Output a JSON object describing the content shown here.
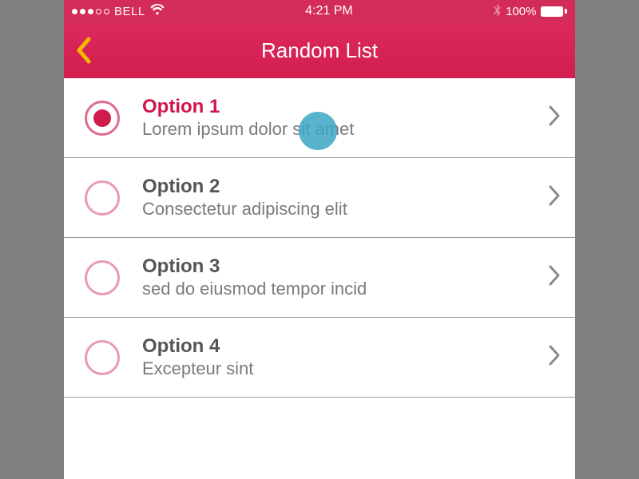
{
  "status": {
    "carrier": "BELL",
    "time": "4:21 PM",
    "battery_pct": "100%"
  },
  "header": {
    "title": "Random List"
  },
  "options": [
    {
      "title": "Option 1",
      "subtitle": "Lorem ipsum dolor sit amet",
      "selected": true
    },
    {
      "title": "Option 2",
      "subtitle": "Consectetur adipiscing elit",
      "selected": false
    },
    {
      "title": "Option 3",
      "subtitle": "sed do eiusmod tempor incid",
      "selected": false
    },
    {
      "title": "Option 4",
      "subtitle": "Excepteur sint",
      "selected": false
    }
  ]
}
